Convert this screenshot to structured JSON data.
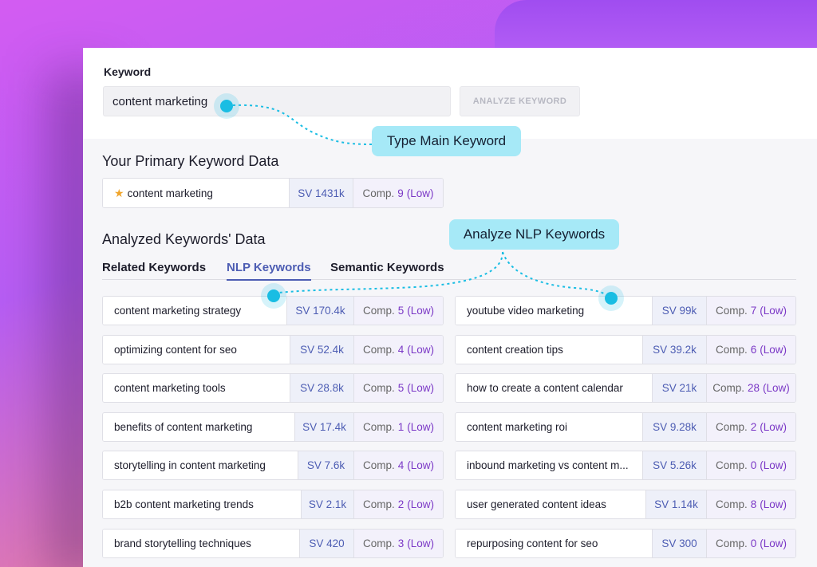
{
  "keyword_section": {
    "label": "Keyword",
    "input_value": "content marketing",
    "analyze_label": "ANALYZE KEYWORD"
  },
  "primary": {
    "title": "Your Primary Keyword Data",
    "keyword": "content marketing",
    "sv": "SV 1431k",
    "comp_label": "Comp.",
    "comp_value": "9",
    "comp_level": "(Low)"
  },
  "analyzed": {
    "title": "Analyzed Keywords' Data",
    "tabs": [
      "Related Keywords",
      "NLP Keywords",
      "Semantic Keywords"
    ],
    "active_tab": "NLP Keywords"
  },
  "tooltips": {
    "type_main": "Type Main Keyword",
    "analyze_nlp": "Analyze NLP Keywords"
  },
  "keywords_left": [
    {
      "keyword": "content marketing strategy",
      "sv": "SV 170.4k",
      "comp": "5",
      "level": "(Low)"
    },
    {
      "keyword": "optimizing content for seo",
      "sv": "SV 52.4k",
      "comp": "4",
      "level": "(Low)"
    },
    {
      "keyword": "content marketing tools",
      "sv": "SV 28.8k",
      "comp": "5",
      "level": "(Low)"
    },
    {
      "keyword": "benefits of content marketing",
      "sv": "SV 17.4k",
      "comp": "1",
      "level": "(Low)"
    },
    {
      "keyword": "storytelling in content marketing",
      "sv": "SV 7.6k",
      "comp": "4",
      "level": "(Low)"
    },
    {
      "keyword": "b2b content marketing trends",
      "sv": "SV 2.1k",
      "comp": "2",
      "level": "(Low)"
    },
    {
      "keyword": "brand storytelling techniques",
      "sv": "SV 420",
      "comp": "3",
      "level": "(Low)"
    }
  ],
  "keywords_right": [
    {
      "keyword": "youtube video marketing",
      "sv": "SV 99k",
      "comp": "7",
      "level": "(Low)"
    },
    {
      "keyword": "content creation tips",
      "sv": "SV 39.2k",
      "comp": "6",
      "level": "(Low)"
    },
    {
      "keyword": "how to create a content calendar",
      "sv": "SV 21k",
      "comp": "28",
      "level": "(Low)"
    },
    {
      "keyword": "content marketing roi",
      "sv": "SV 9.28k",
      "comp": "2",
      "level": "(Low)"
    },
    {
      "keyword": "inbound marketing vs content m...",
      "sv": "SV 5.26k",
      "comp": "0",
      "level": "(Low)"
    },
    {
      "keyword": "user generated content ideas",
      "sv": "SV 1.14k",
      "comp": "8",
      "level": "(Low)"
    },
    {
      "keyword": "repurposing content for seo",
      "sv": "SV 300",
      "comp": "0",
      "level": "(Low)"
    }
  ],
  "colors": {
    "accent": "#4d5db3",
    "comp_purple": "#7b38c6",
    "tooltip_bg": "#a6e9f7",
    "dot": "#19bde3",
    "star": "#f0a52c"
  }
}
